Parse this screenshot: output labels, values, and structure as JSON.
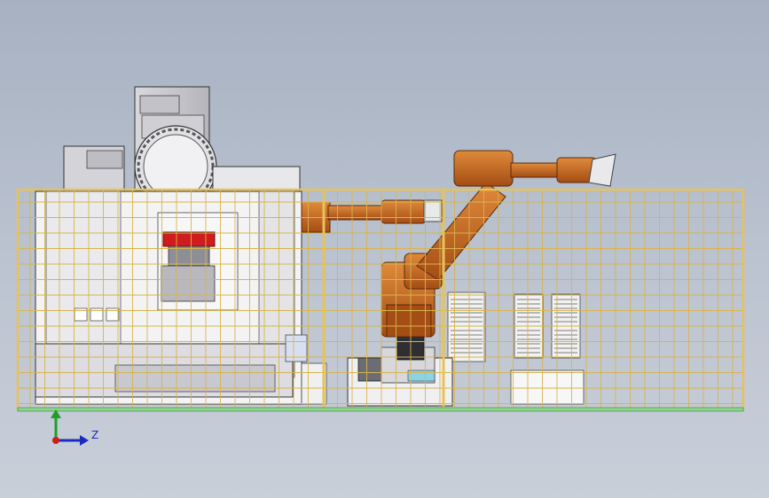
{
  "view": {
    "background_top": "#a7b1c1",
    "background_bottom": "#c9cfd9"
  },
  "colors": {
    "robot_orange": "#c9651f",
    "robot_dark": "#7a3a10",
    "fence_frame": "#e6c25a",
    "fence_grid": "#d7b44d",
    "machine_white": "#f3f3f3",
    "machine_gray": "#c8c8cc",
    "spindle_red": "#d01c1c",
    "floor_green": "#8fd48f",
    "axis_y": "#1f9e2a",
    "axis_z": "#1a2bbf",
    "axis_origin": "#d01c1c"
  },
  "triad": {
    "z_label": "Z",
    "icons": [
      "y-axis-arrow-icon",
      "z-axis-arrow-icon",
      "origin-dot-icon"
    ]
  }
}
